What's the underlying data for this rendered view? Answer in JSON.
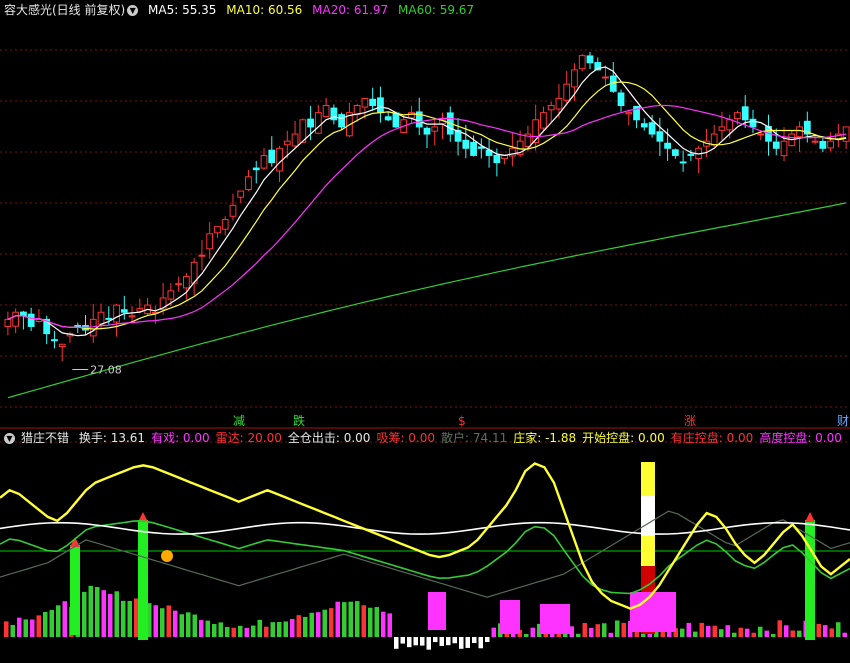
{
  "top_legend": {
    "title": "容大感光(日线 前复权)",
    "icon": "chevron-down-icon",
    "ma5": "MA5: 55.35",
    "ma10": "MA10: 60.56",
    "ma20": "MA20: 61.97",
    "ma60": "MA60: 59.67"
  },
  "bottom_legend": {
    "title": "猎庄不错",
    "icon": "chevron-down-icon",
    "items": [
      {
        "text": "换手: 13.61",
        "color": "#e6e6e6"
      },
      {
        "text": "有戏: 0.00",
        "color": "#ff33ff"
      },
      {
        "text": "雷达: 20.00",
        "color": "#ff3333"
      },
      {
        "text": "全仓出击: 0.00",
        "color": "#e6e6e6"
      },
      {
        "text": "吸筹: 0.00",
        "color": "#ff3333"
      },
      {
        "text": "散户: 74.11",
        "color": "#607060"
      },
      {
        "text": "庄家: -1.88",
        "color": "#ffff33"
      },
      {
        "text": "开始控盘: 0.00",
        "color": "#ffff33"
      },
      {
        "text": "有庄控盘: 0.00",
        "color": "#ff3333"
      },
      {
        "text": "高度控盘: 0.00",
        "color": "#ff33ff"
      }
    ]
  },
  "signals": [
    {
      "text": "减",
      "color": "#33dd33",
      "at": 0.28
    },
    {
      "text": "跌",
      "color": "#33dd33",
      "at": 0.35
    },
    {
      "text": "$",
      "color": "#ff3333",
      "at": 0.545
    },
    {
      "text": "涨",
      "color": "#ff3333",
      "at": 0.81
    },
    {
      "text": "财",
      "color": "#66aaff",
      "at": 0.99
    }
  ],
  "colors": {
    "up": "#ff3333",
    "down": "#33ffff",
    "ma5": "#ffffff",
    "ma10": "#ffff44",
    "ma20": "#ff33ff",
    "ma60": "#33cc33",
    "grid": "#7a1010",
    "separator": "#aa1111",
    "retail": "#556b55",
    "banker": "#ffff33",
    "white_line": "#ffffff",
    "green_line": "#33cc33",
    "ref_line": "#00cc00"
  },
  "chart_data": [
    {
      "type": "candlestick",
      "title": "容大感光(日线 前复权)",
      "ylim": [
        20,
        75
      ],
      "annotations": [
        {
          "text": "27.08",
          "x_index": 7,
          "value": 27.08
        }
      ],
      "close_path": [
        33,
        34,
        33.5,
        32,
        33,
        31,
        30,
        29.5,
        31,
        32,
        31.5,
        33,
        34,
        33,
        35,
        34,
        33.5,
        34.5,
        35,
        34,
        36,
        37,
        38,
        39,
        41,
        42,
        45,
        46,
        47,
        49,
        51,
        53,
        54,
        56,
        55,
        57,
        58,
        59,
        61,
        60,
        62,
        63,
        61,
        60,
        62,
        63,
        64,
        63,
        62,
        61,
        60,
        61,
        62,
        60,
        59,
        60,
        61,
        59,
        58,
        57,
        56,
        57,
        56,
        55,
        56,
        57,
        58,
        59,
        61,
        62,
        63,
        64,
        66,
        68,
        70,
        69,
        68,
        67,
        65,
        63,
        62,
        61,
        60,
        59,
        58,
        57,
        56,
        55,
        56,
        57,
        58,
        59,
        60,
        61,
        62,
        61,
        60,
        59,
        58,
        57,
        58,
        59,
        60,
        59,
        58,
        57,
        58,
        59,
        60
      ],
      "ma5_last": 55.35,
      "ma10_last": 60.56,
      "ma20_last": 61.97,
      "ma60_last": 59.67
    },
    {
      "type": "indicator",
      "title": "猎庄不错",
      "series": [
        {
          "name": "庄家",
          "values": [
            76,
            80,
            78,
            74,
            70,
            66,
            64,
            68,
            74,
            80,
            84,
            86,
            88,
            90,
            92,
            93,
            92,
            90,
            88,
            86,
            84,
            82,
            80,
            78,
            76,
            74,
            76,
            78,
            80,
            78,
            76,
            74,
            72,
            70,
            68,
            66,
            64,
            62,
            60,
            58,
            56,
            54,
            52,
            50,
            48,
            46,
            45,
            46,
            48,
            50,
            54,
            60,
            66,
            72,
            80,
            90,
            94,
            92,
            84,
            70,
            56,
            42,
            32,
            26,
            22,
            20,
            18,
            20,
            24,
            30,
            38,
            46,
            54,
            62,
            68,
            66,
            60,
            52,
            46,
            42,
            46,
            52,
            58,
            62,
            56,
            48,
            40,
            36,
            40,
            44
          ]
        },
        {
          "name": "散户",
          "values": [
            30,
            32,
            34,
            36,
            38,
            40,
            44,
            48,
            52,
            56,
            54,
            52,
            50,
            48,
            46,
            44,
            42,
            40,
            38,
            36,
            34,
            32,
            30,
            28,
            26,
            24,
            26,
            28,
            30,
            32,
            34,
            36,
            38,
            40,
            42,
            44,
            46,
            44,
            42,
            40,
            38,
            36,
            34,
            32,
            30,
            28,
            26,
            24,
            22,
            20,
            18,
            16,
            18,
            20,
            22,
            24,
            26,
            28,
            30,
            32,
            36,
            40,
            44,
            48,
            52,
            56,
            60,
            64,
            68,
            72,
            76,
            74,
            70,
            66,
            62,
            58,
            54,
            52,
            56,
            60,
            64,
            68,
            70,
            66,
            62,
            58,
            54,
            50,
            52,
            54
          ]
        }
      ]
    }
  ]
}
